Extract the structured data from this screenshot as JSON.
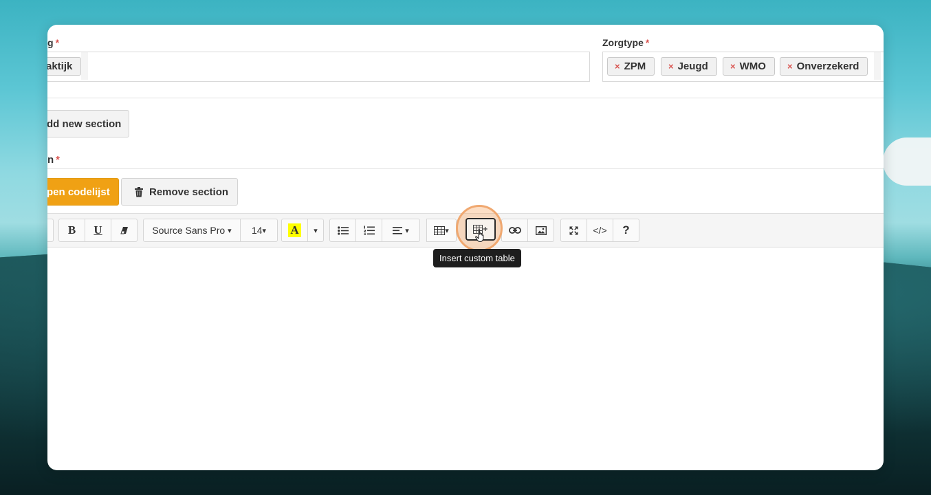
{
  "form": {
    "left_label_fragment": "g",
    "left_tag_fragment": "aktijk",
    "zorgtype_label": "Zorgtype",
    "required_marker": "*",
    "zorgtype_tags": [
      {
        "label": "ZPM"
      },
      {
        "label": "Jeugd"
      },
      {
        "label": "WMO"
      },
      {
        "label": "Onverzekerd"
      }
    ],
    "remove_tag_glyph": "×"
  },
  "sections": {
    "add_section_label": "dd new section",
    "section_label_fragment": "n",
    "open_codelist_label": "pen codelijst",
    "remove_section_label": "Remove section"
  },
  "editor_toolbar": {
    "bold": "B",
    "underline": "U",
    "font_family": "Source Sans Pro",
    "font_size": "14",
    "highlight_letter": "A",
    "highlight_color": "#ffff00",
    "code_view": "</>",
    "help": "?",
    "caret": "▾"
  },
  "tooltip": {
    "text": "Insert custom table"
  },
  "colors": {
    "accent_orange": "#f0a114",
    "required_red": "#d9534f"
  }
}
